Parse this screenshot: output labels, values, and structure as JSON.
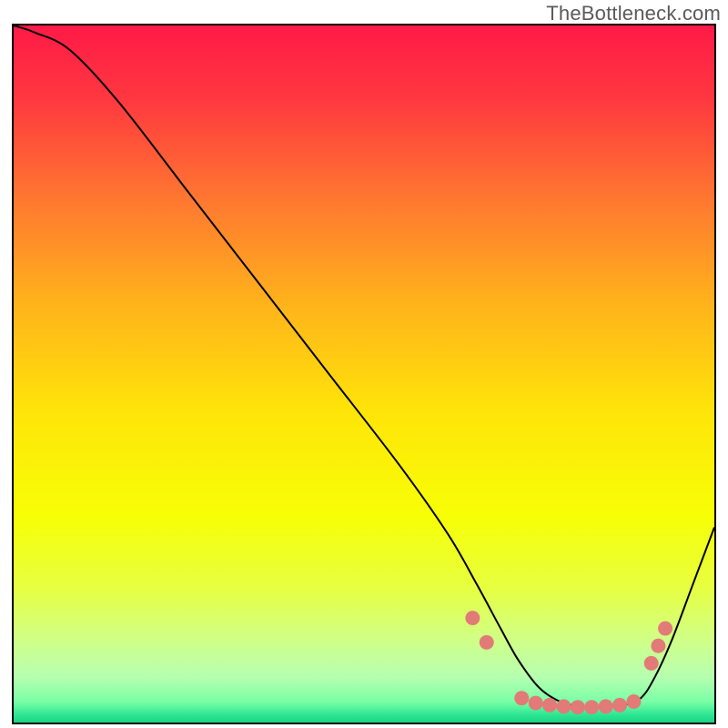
{
  "watermark": "TheBottleneck.com",
  "chart_data": {
    "type": "line",
    "title": "",
    "xlabel": "",
    "ylabel": "",
    "xlim": [
      0,
      100
    ],
    "ylim": [
      0,
      100
    ],
    "background_gradient_stops": [
      {
        "offset": 0.0,
        "color": "#ff1a47"
      },
      {
        "offset": 0.1,
        "color": "#ff3640"
      },
      {
        "offset": 0.25,
        "color": "#ff7830"
      },
      {
        "offset": 0.4,
        "color": "#ffb41b"
      },
      {
        "offset": 0.55,
        "color": "#ffe409"
      },
      {
        "offset": 0.7,
        "color": "#f7ff05"
      },
      {
        "offset": 0.8,
        "color": "#e7ff3f"
      },
      {
        "offset": 0.88,
        "color": "#cfff8a"
      },
      {
        "offset": 0.93,
        "color": "#b6ffb0"
      },
      {
        "offset": 0.965,
        "color": "#7affa6"
      },
      {
        "offset": 0.985,
        "color": "#29e492"
      },
      {
        "offset": 1.0,
        "color": "#18c97f"
      }
    ],
    "series": [
      {
        "name": "bottleneck-curve",
        "x": [
          0.0,
          3.0,
          8.0,
          15.0,
          25.0,
          35.0,
          45.0,
          55.0,
          62.0,
          66.0,
          69.5,
          72.0,
          75.0,
          78.0,
          81.0,
          84.0,
          87.0,
          89.5,
          91.5,
          94.0,
          97.0,
          100.0
        ],
        "y": [
          100.0,
          99.0,
          96.5,
          89.0,
          76.0,
          63.0,
          50.0,
          37.0,
          27.0,
          20.0,
          13.5,
          9.0,
          5.0,
          3.0,
          2.3,
          2.2,
          2.5,
          3.5,
          6.5,
          12.0,
          20.0,
          28.0
        ]
      }
    ],
    "markers": {
      "name": "flat-region-dots",
      "color": "#e27a78",
      "radius_px": 8,
      "points": [
        {
          "x": 65.5,
          "y": 15.0
        },
        {
          "x": 67.5,
          "y": 11.5
        },
        {
          "x": 72.5,
          "y": 3.5
        },
        {
          "x": 74.5,
          "y": 2.8
        },
        {
          "x": 76.5,
          "y": 2.5
        },
        {
          "x": 78.5,
          "y": 2.3
        },
        {
          "x": 80.5,
          "y": 2.2
        },
        {
          "x": 82.5,
          "y": 2.2
        },
        {
          "x": 84.5,
          "y": 2.3
        },
        {
          "x": 86.5,
          "y": 2.5
        },
        {
          "x": 88.5,
          "y": 3.0
        },
        {
          "x": 91.0,
          "y": 8.5
        },
        {
          "x": 92.0,
          "y": 11.0
        },
        {
          "x": 93.0,
          "y": 13.5
        }
      ]
    }
  }
}
